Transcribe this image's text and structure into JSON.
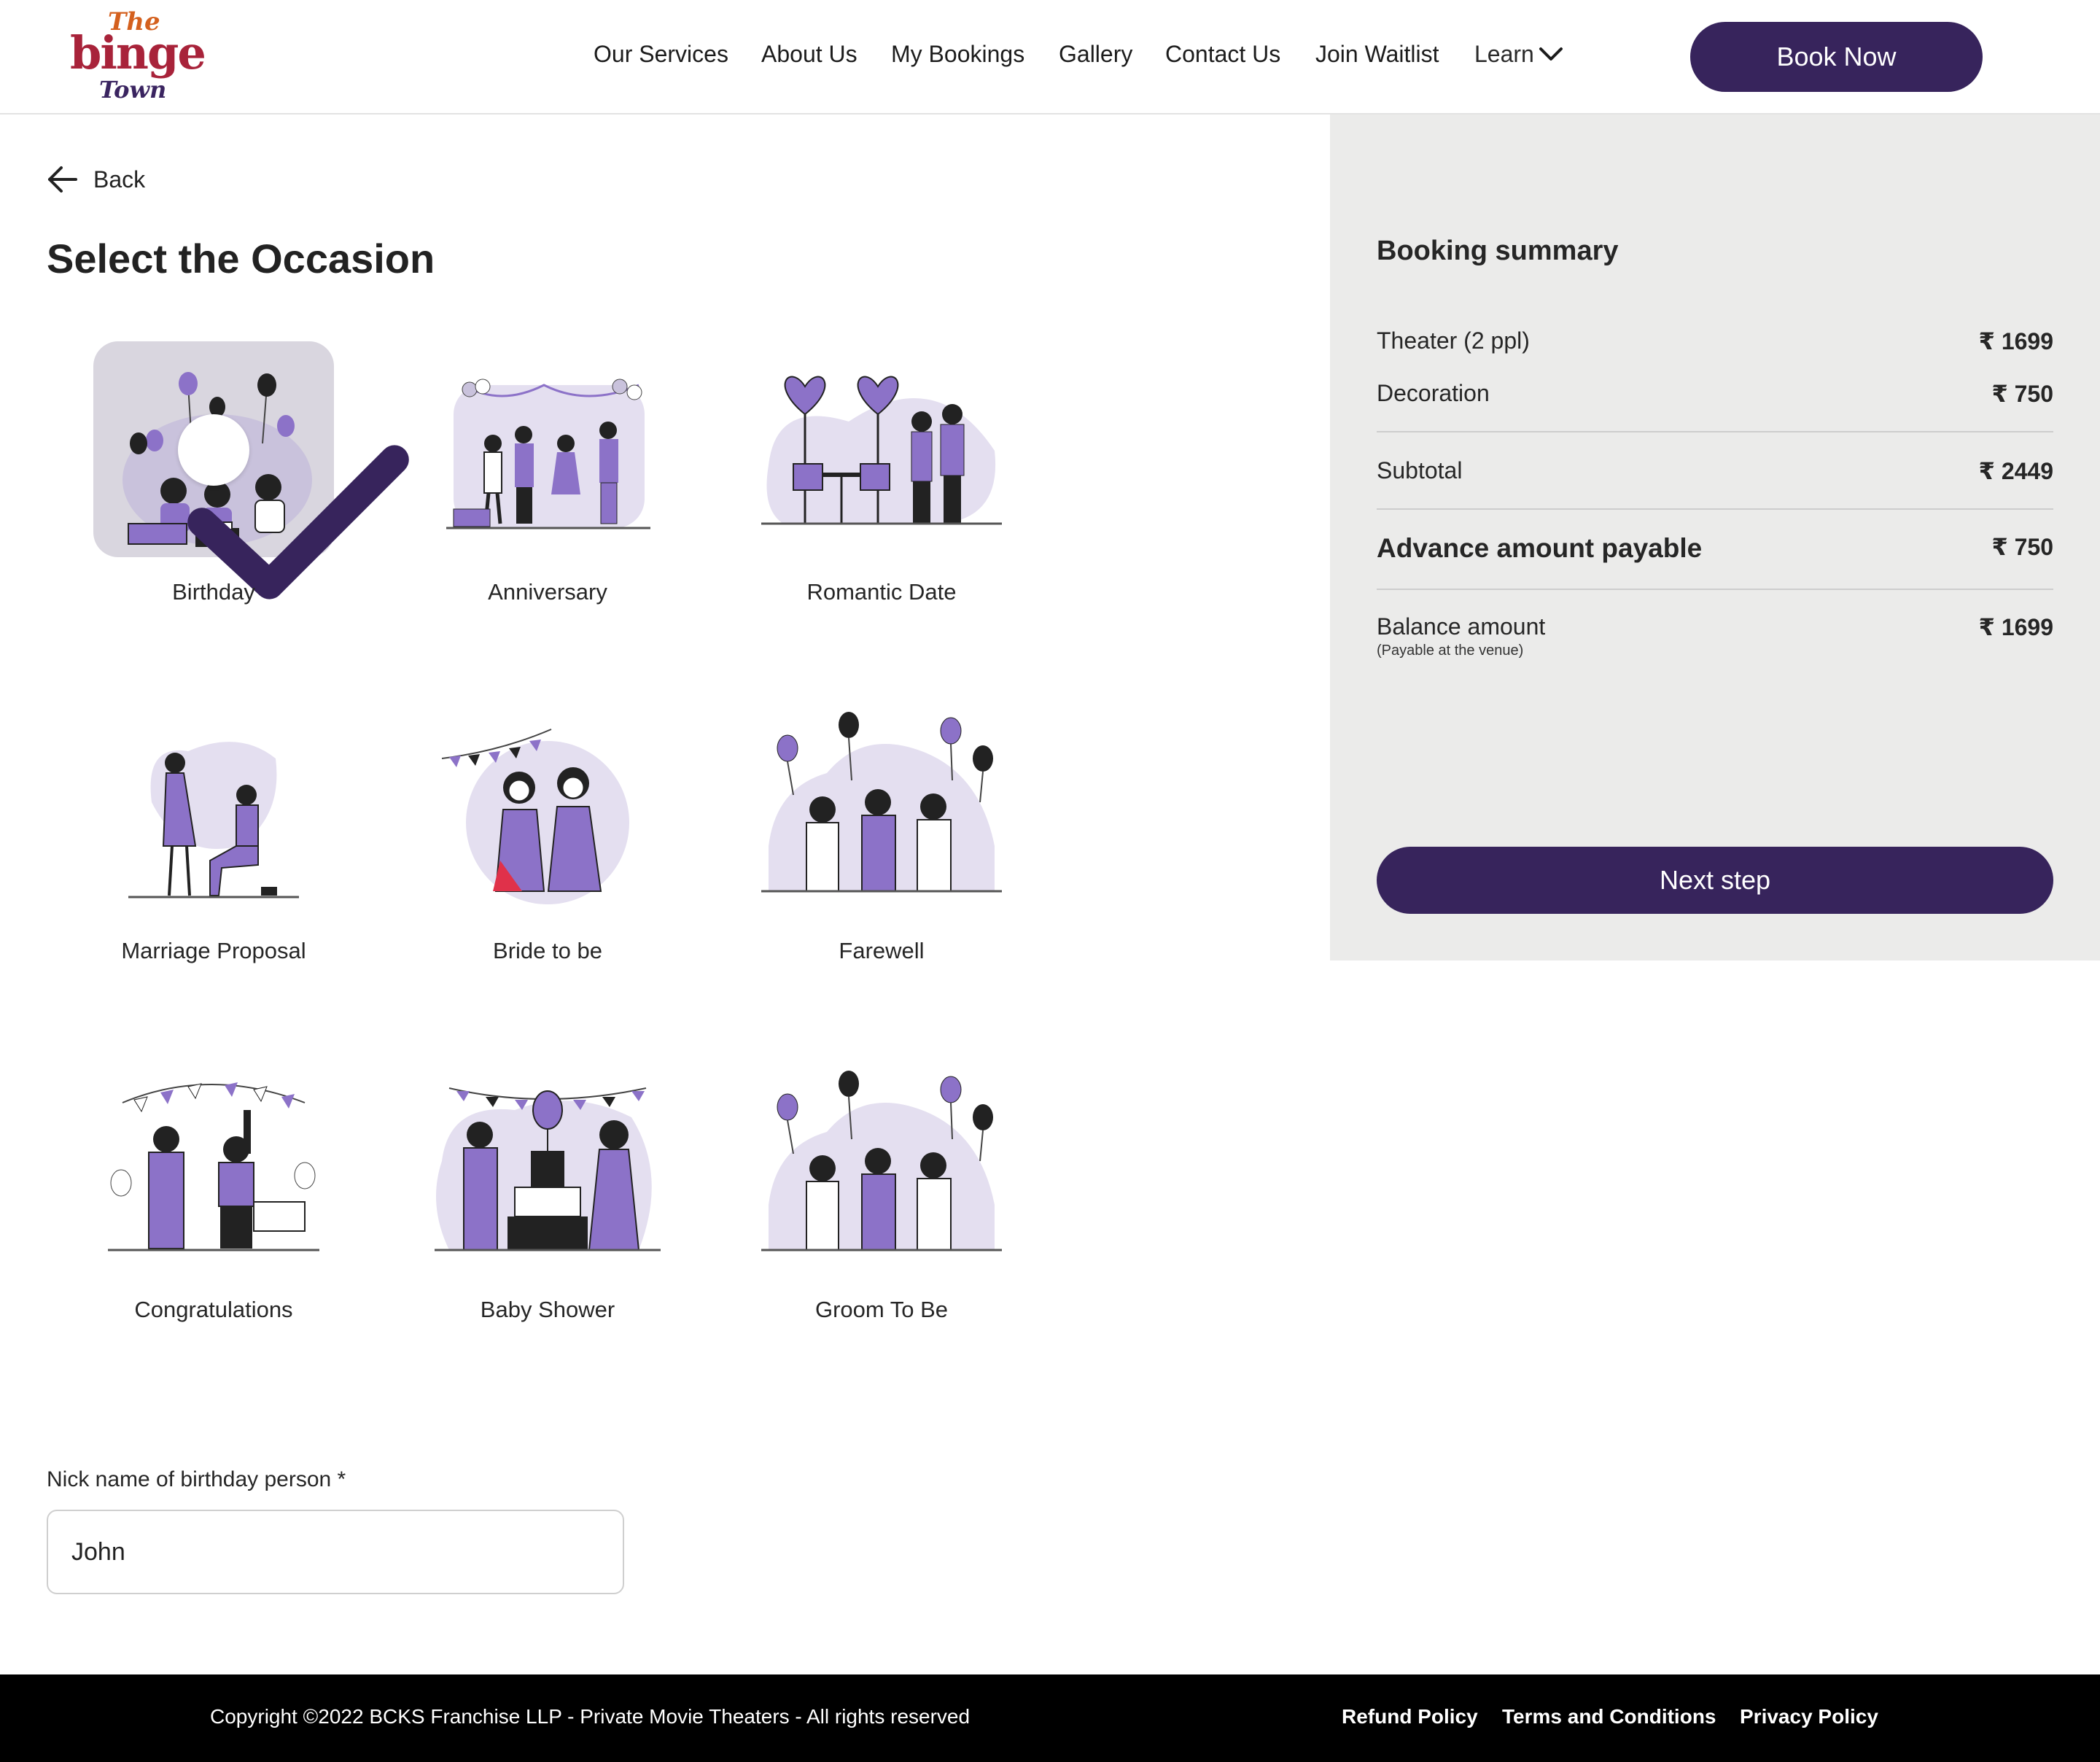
{
  "header": {
    "logo": {
      "line1": "The",
      "line2": "binge",
      "line3": "Town"
    },
    "nav": [
      {
        "label": "Our Services"
      },
      {
        "label": "About Us"
      },
      {
        "label": "My Bookings"
      },
      {
        "label": "Gallery"
      },
      {
        "label": "Contact Us"
      },
      {
        "label": "Join Waitlist"
      },
      {
        "label": "Learn",
        "icon": "chevron-down-icon"
      }
    ],
    "book_now_label": "Book Now"
  },
  "back_label": "Back",
  "page_title": "Select the Occasion",
  "occasions": [
    {
      "label": "Birthday",
      "selected": true
    },
    {
      "label": "Anniversary",
      "selected": false
    },
    {
      "label": "Romantic Date",
      "selected": false
    },
    {
      "label": "Marriage Proposal",
      "selected": false
    },
    {
      "label": "Bride to be",
      "selected": false
    },
    {
      "label": "Farewell",
      "selected": false
    },
    {
      "label": "Congratulations",
      "selected": false
    },
    {
      "label": "Baby Shower",
      "selected": false
    },
    {
      "label": "Groom To Be",
      "selected": false
    }
  ],
  "nickname_field": {
    "label": "Nick name of birthday person *",
    "value": "John"
  },
  "summary": {
    "title": "Booking summary",
    "rows": {
      "theater": {
        "label": "Theater (2 ppl)",
        "value": "₹ 1699"
      },
      "decoration": {
        "label": "Decoration",
        "value": "₹ 750"
      },
      "subtotal": {
        "label": "Subtotal",
        "value": "₹ 2449"
      },
      "advance": {
        "label": "Advance amount payable",
        "value": "₹ 750"
      },
      "balance": {
        "label": "Balance amount",
        "note": "(Payable at the venue)",
        "value": "₹ 1699"
      }
    },
    "next_label": "Next step"
  },
  "footer": {
    "copyright": "Copyright ©2022 BCKS Franchise LLP - Private Movie Theaters - All rights reserved",
    "links": [
      "Refund Policy",
      "Terms and Conditions",
      "Privacy Policy"
    ]
  },
  "colors": {
    "brand": "#37245c",
    "accent": "#8c72c8",
    "selected_tile": "#d9d6df",
    "summary_bg": "#ebebea",
    "footer_bg": "#000000"
  }
}
